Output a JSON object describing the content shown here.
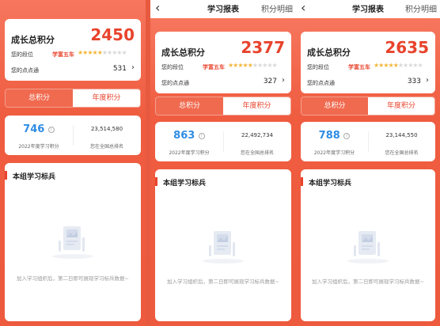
{
  "colors": {
    "accent": "#e8432c",
    "blue": "#2f8de4",
    "background": "#ee5a3e"
  },
  "columns": [
    {
      "topbar": null,
      "header": {
        "title": "",
        "right": ""
      },
      "score": {
        "label": "成长总积分",
        "value": "2450",
        "rank_label": "您的段位",
        "rank_name": "学富五车",
        "stars_on": "★★★★★",
        "stars_off": "★★★★★",
        "points_label": "您的点点通",
        "points_value": "531"
      },
      "tabs": {
        "total": "总积分",
        "annual": "年度积分"
      },
      "stats": {
        "year_points": "746",
        "year_caption": "2022年度学习积分",
        "rank": "23,514,580",
        "rank_caption": "您在全国总排名"
      },
      "board": {
        "title": "本组学习标兵",
        "empty_text": "加入学习组织后，第二日即可展现学习标兵数据~"
      }
    },
    {
      "header": {
        "back": "‹",
        "title": "学习报表",
        "right": "积分明细"
      },
      "score": {
        "label": "成长总积分",
        "value": "2377",
        "rank_label": "您的段位",
        "rank_name": "学富五车",
        "stars_on": "★★★★★",
        "stars_off": "★★★★★",
        "points_label": "您的点点通",
        "points_value": "327"
      },
      "tabs": {
        "total": "总积分",
        "annual": "年度积分"
      },
      "stats": {
        "year_points": "863",
        "year_caption": "2022年度学习积分",
        "rank": "22,492,734",
        "rank_caption": "您在全国总排名"
      },
      "board": {
        "title": "本组学习标兵",
        "empty_text": "加入学习组织后，第二日即可展现学习标兵数据~"
      }
    },
    {
      "header": {
        "back": "‹",
        "title": "学习报表",
        "right": "积分明细"
      },
      "score": {
        "label": "成长总积分",
        "value": "2635",
        "rank_label": "您的段位",
        "rank_name": "学富五车",
        "stars_on": "★★★★★",
        "stars_off": "★★★★★",
        "points_label": "您的点点通",
        "points_value": "333"
      },
      "tabs": {
        "total": "总积分",
        "annual": "年度积分"
      },
      "stats": {
        "year_points": "788",
        "year_caption": "2022年度学习积分",
        "rank": "23,144,550",
        "rank_caption": "您在全国总排名"
      },
      "board": {
        "title": "本组学习标兵",
        "empty_text": "加入学习组织后，第二日即可展现学习标兵数据~"
      }
    }
  ],
  "icons": {
    "back": "chevron-left-icon",
    "more": "chevron-right-icon",
    "info": "info-icon",
    "empty": "empty-illustration"
  }
}
